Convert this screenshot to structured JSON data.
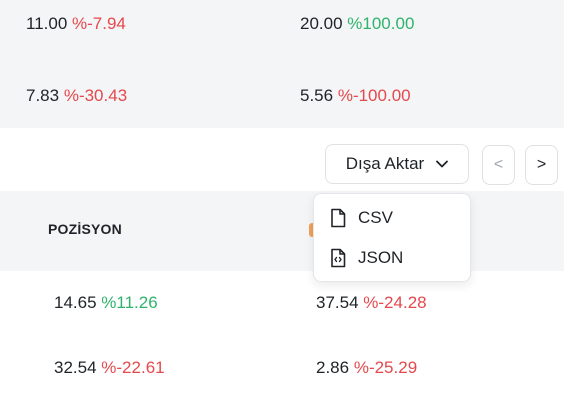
{
  "top_rows": [
    {
      "left_value": "11.00",
      "left_change": "%-7.94",
      "right_value": "20.00",
      "right_change": "%100.00"
    },
    {
      "left_value": "7.83",
      "left_change": "%-30.43",
      "right_value": "5.56",
      "right_change": "%-100.00"
    }
  ],
  "toolbar": {
    "export_label": "Dışa Aktar",
    "prev_label": "<",
    "next_label": ">"
  },
  "export_menu": {
    "items": [
      {
        "label": "CSV",
        "icon": "file-icon"
      },
      {
        "label": "JSON",
        "icon": "file-code-icon"
      }
    ]
  },
  "table": {
    "header": "POZİSYON",
    "rows": [
      {
        "left_value": "14.65",
        "left_change": "%11.26",
        "right_value": "37.54",
        "right_change": "%-24.28"
      },
      {
        "left_value": "32.54",
        "left_change": "%-22.61",
        "right_value": "2.86",
        "right_change": "%-25.29"
      }
    ]
  },
  "colors": {
    "negative": "#e5484d",
    "positive": "#2fb36b",
    "row_bg": "#f4f5f7"
  }
}
